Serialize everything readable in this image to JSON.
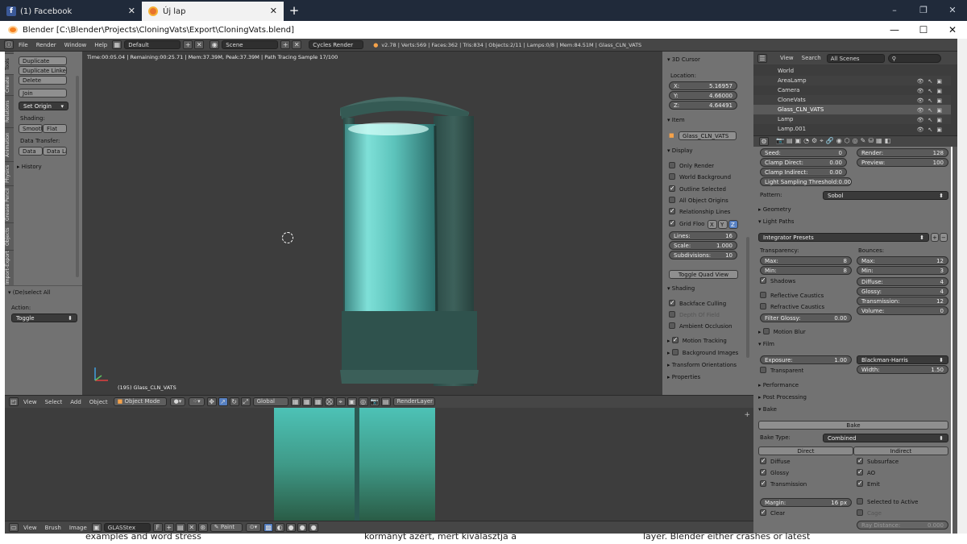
{
  "browser": {
    "tabs": [
      {
        "label": "(1) Facebook"
      },
      {
        "label": "Új lap"
      }
    ]
  },
  "window": {
    "title": "Blender [C:\\Blender\\Projects\\CloningVats\\Export\\CloningVats.blend]"
  },
  "header": {
    "menus": [
      "File",
      "Render",
      "Window",
      "Help"
    ],
    "layout": "Default",
    "scene": "Scene",
    "engine": "Cycles Render",
    "stats": "v2.78 | Verts:569 | Faces:362 | Tris:834 | Objects:2/11 | Lamps:0/8 | Mem:84.51M | Glass_CLN_VATS"
  },
  "toolshelf": {
    "tabs": [
      "Tools",
      "Create",
      "Relations",
      "Animation",
      "Physics",
      "Grease Pencil",
      "Objects",
      "Import-Export"
    ],
    "buttons": [
      "Duplicate",
      "Duplicate Linked",
      "Delete",
      "Join",
      "Set Origin"
    ],
    "shading_label": "Shading:",
    "smooth": "Smooth",
    "flat": "Flat",
    "data_transfer_label": "Data Transfer:",
    "data": "Data",
    "data_la": "Data La",
    "history": "History"
  },
  "operator": {
    "title": "(De)select All",
    "action_label": "Action:",
    "action_value": "Toggle"
  },
  "viewport": {
    "info": "Time:00:05.04 | Remaining:00:25.71 | Mem:37.39M, Peak:37.39M | Path Tracing Sample 17/100",
    "object_label": "(195) Glass_CLN_VATS"
  },
  "npanel": {
    "cursor_title": "3D Cursor",
    "location_label": "Location:",
    "x": "5.16957",
    "y": "4.66000",
    "z": "4.64491",
    "item_title": "Item",
    "item_name": "Glass_CLN_VATS",
    "display_title": "Display",
    "display_opts": [
      {
        "label": "Only Render",
        "on": false
      },
      {
        "label": "World Background",
        "on": false
      },
      {
        "label": "Outline Selected",
        "on": true
      },
      {
        "label": "All Object Origins",
        "on": false
      },
      {
        "label": "Relationship Lines",
        "on": true
      }
    ],
    "grid_floor": "Grid Floo",
    "lines": "16",
    "scale": "1.000",
    "subdivisions": "10",
    "toggle_quad": "Toggle Quad View",
    "shading_title": "Shading",
    "shading_opts": [
      {
        "label": "Backface Culling",
        "on": true
      },
      {
        "label": "Depth Of Field",
        "on": false
      },
      {
        "label": "Ambient Occlusion",
        "on": false
      }
    ],
    "collapsed": [
      "Motion Tracking",
      "Background Images",
      "Transform Orientations",
      "Properties"
    ]
  },
  "viewport_header": {
    "menus": [
      "View",
      "Select",
      "Add",
      "Object"
    ],
    "mode": "Object Mode",
    "orientation": "Global",
    "render_layer": "RenderLayer"
  },
  "uv_header": {
    "menus": [
      "View",
      "Brush",
      "Image"
    ],
    "image": "GLASStex",
    "f": "F",
    "paint": "Paint"
  },
  "outliner": {
    "view": "View",
    "search": "Search",
    "scenes": "All Scenes",
    "items": [
      {
        "name": "World",
        "selected": false
      },
      {
        "name": "AreaLamp",
        "selected": false
      },
      {
        "name": "Camera",
        "selected": false
      },
      {
        "name": "CloneVats",
        "selected": false
      },
      {
        "name": "Glass_CLN_VATS",
        "selected": true
      },
      {
        "name": "Lamp",
        "selected": false
      },
      {
        "name": "Lamp.001",
        "selected": false
      }
    ]
  },
  "properties": {
    "seed": "0",
    "clamp_direct": "0.00",
    "clamp_indirect": "0.00",
    "light_threshold": "0.00",
    "render": "128",
    "preview": "100",
    "pattern_label": "Pattern:",
    "pattern": "Sobol",
    "geometry": "Geometry",
    "light_paths": "Light Paths",
    "integrator_presets": "Integrator Presets",
    "transparency_label": "Transparency:",
    "t_max": "8",
    "t_min": "8",
    "shadows": "Shadows",
    "refl_caustics": "Reflective Caustics",
    "refr_caustics": "Refractive Caustics",
    "filter_glossy": "0.00",
    "bounces_label": "Bounces:",
    "b_max": "12",
    "b_min": "3",
    "diffuse": "4",
    "glossy": "4",
    "transmission": "12",
    "volume": "0",
    "motion_blur": "Motion Blur",
    "film": "Film",
    "exposure": "1.00",
    "filter": "Blackman-Harris",
    "transparent": "Transparent",
    "width": "1.50",
    "performance": "Performance",
    "post_processing": "Post Processing",
    "bake": "Bake",
    "bake_btn": "Bake",
    "bake_type_label": "Bake Type:",
    "bake_type": "Combined",
    "direct": "Direct",
    "indirect": "Indirect",
    "direct_opts": [
      "Diffuse",
      "Glossy",
      "Transmission"
    ],
    "indirect_opts": [
      "Subsurface",
      "AO",
      "Emit"
    ],
    "margin": "16 px",
    "clear": "Clear",
    "selected_to_active": "Selected to Active",
    "cage": "Cage",
    "ray_distance": "0.000"
  },
  "bottom_text": [
    "examples and word stress",
    "kormányt azért, mert kiválasztja a",
    "layer. Blender either crashes or latest"
  ]
}
